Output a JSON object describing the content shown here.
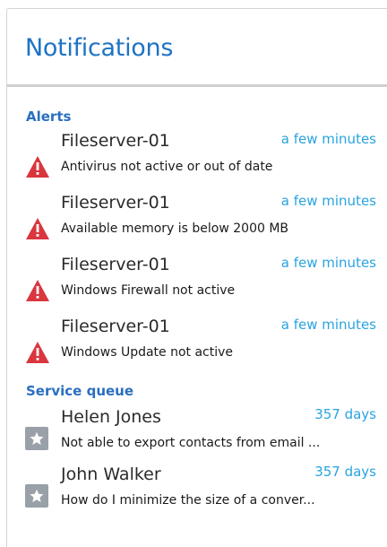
{
  "header": {
    "title": "Notifications"
  },
  "alerts": {
    "title": "Alerts",
    "items": [
      {
        "name": "Fileserver-01",
        "time": "a few minutes",
        "desc": "Antivirus not active or out of date"
      },
      {
        "name": "Fileserver-01",
        "time": "a few minutes",
        "desc": "Available memory is below 2000 MB"
      },
      {
        "name": "Fileserver-01",
        "time": "a few minutes",
        "desc": "Windows Firewall not active"
      },
      {
        "name": "Fileserver-01",
        "time": "a few minutes",
        "desc": "Windows Update not active"
      }
    ]
  },
  "service_queue": {
    "title": "Service queue",
    "items": [
      {
        "name": "Helen Jones",
        "time": "357 days",
        "desc": "Not able to export contacts from email ..."
      },
      {
        "name": "John Walker",
        "time": "357 days",
        "desc": "How do I minimize the size of a conver..."
      }
    ]
  },
  "colors": {
    "accent": "#1e73c4",
    "time": "#29a3e0",
    "warning": "#d9363e",
    "star_bg": "#9aa0a8"
  },
  "icons": {
    "alert": "warning-triangle-icon",
    "ticket": "star-icon"
  }
}
